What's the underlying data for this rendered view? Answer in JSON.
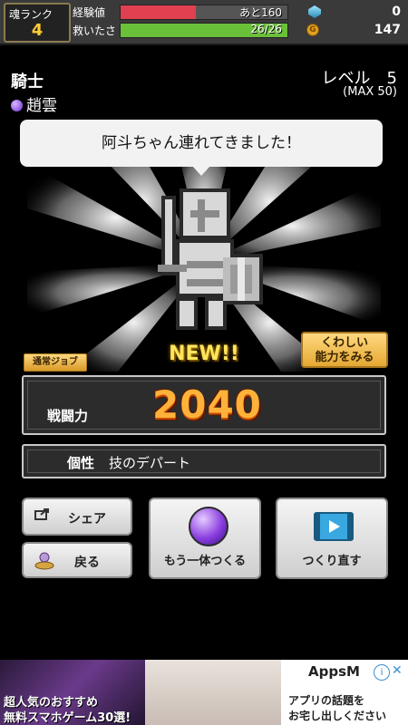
{
  "status": {
    "rank_label": "魂ランク",
    "rank_value": "4",
    "exp_label": "経験値",
    "exp_text": "あと160",
    "exp_fill": 0.45,
    "hp_label": "救いたさ",
    "hp_text": "26/26",
    "hp_fill": 1.0,
    "gems": "0",
    "coins": "147",
    "colors": {
      "exp": "#e04050",
      "hp": "#6bc03a"
    }
  },
  "character": {
    "job": "騎士",
    "name": "趙雲",
    "level_text": "レベル　5",
    "level_max": "(MAX 50)",
    "speech": "阿斗ちゃん連れてきました！",
    "new_label": "NEW!!",
    "detail_button": [
      "くわしい",
      "能力をみる"
    ],
    "job_tag": "通常ジョブ"
  },
  "stats": {
    "power_label": "戦闘力",
    "power_value": "2040",
    "trait_label": "個性",
    "trait_value": "技のデパート"
  },
  "actions": {
    "share": "シェア",
    "back": "戻る",
    "make_another": "もう一体つくる",
    "remake": "つくり直す"
  },
  "ad": {
    "line1": "超人気のおすすめ",
    "line2": "無料スマホゲーム30選!",
    "brand": "AppsM",
    "copy1": "アプリの話題を",
    "copy2": "お宅し出しください",
    "info": "i",
    "close": "✕"
  }
}
